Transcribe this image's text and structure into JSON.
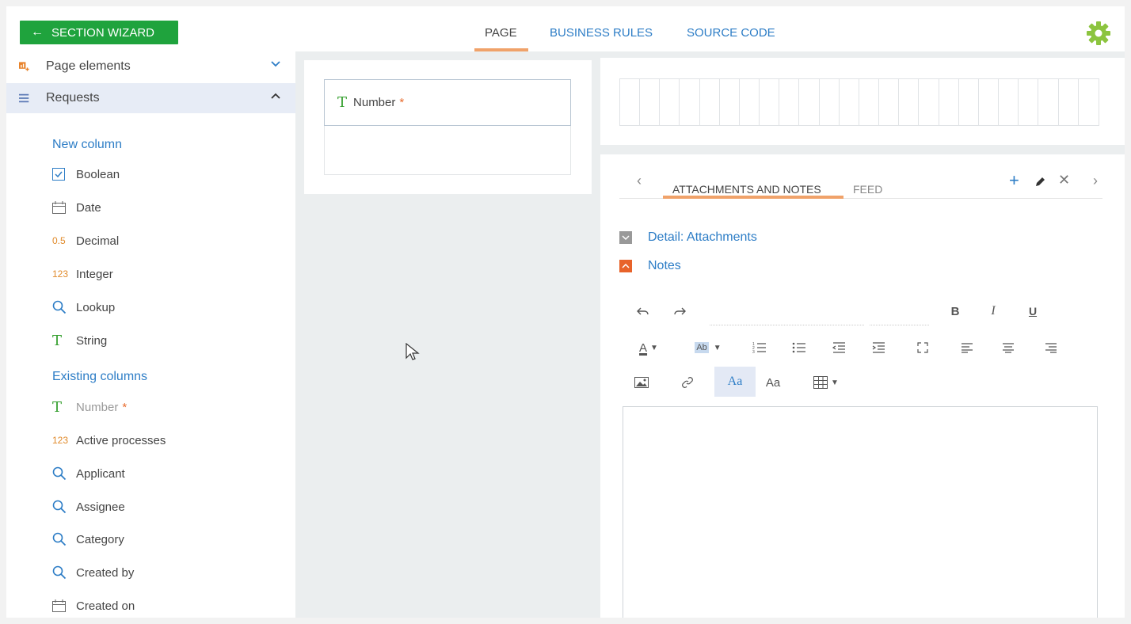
{
  "topbar": {
    "wizard_label": "SECTION WIZARD",
    "tabs": [
      "PAGE",
      "BUSINESS RULES",
      "SOURCE CODE"
    ],
    "active_tab": "PAGE"
  },
  "sidebar": {
    "page_elements_label": "Page elements",
    "requests_label": "Requests",
    "new_column_heading": "New column",
    "new_columns": [
      {
        "icon": "checkbox-icon",
        "label": "Boolean"
      },
      {
        "icon": "calendar-icon",
        "label": "Date"
      },
      {
        "icon": "0.5",
        "label": "Decimal"
      },
      {
        "icon": "123",
        "label": "Integer"
      },
      {
        "icon": "search-icon",
        "label": "Lookup"
      },
      {
        "icon": "T",
        "label": "String"
      }
    ],
    "existing_columns_heading": "Existing columns",
    "existing_columns": [
      {
        "icon": "T",
        "label": "Number",
        "required": "*"
      },
      {
        "icon": "123",
        "label": "Active processes"
      },
      {
        "icon": "search-icon",
        "label": "Applicant"
      },
      {
        "icon": "search-icon",
        "label": "Assignee"
      },
      {
        "icon": "search-icon",
        "label": "Category"
      },
      {
        "icon": "search-icon",
        "label": "Created by"
      },
      {
        "icon": "calendar-icon",
        "label": "Created on"
      }
    ]
  },
  "page_panel": {
    "field_icon": "T",
    "field_label": "Number",
    "field_required": "*"
  },
  "notes_panel": {
    "tabs": [
      "ATTACHMENTS AND NOTES",
      "FEED"
    ],
    "active_tab": "ATTACHMENTS AND NOTES",
    "detail_attachments": "Detail: Attachments",
    "notes_label": "Notes",
    "rte": {
      "bold": "B",
      "italic": "I",
      "underline": "U",
      "font_color": "A",
      "highlight": "Ab",
      "font_style_1": "Aa",
      "font_style_2": "Aa"
    }
  },
  "colors": {
    "accent_green": "#1fa33d",
    "link_blue": "#2d7dc6",
    "tab_underline": "#f0a26a",
    "required": "#e86b2d"
  }
}
